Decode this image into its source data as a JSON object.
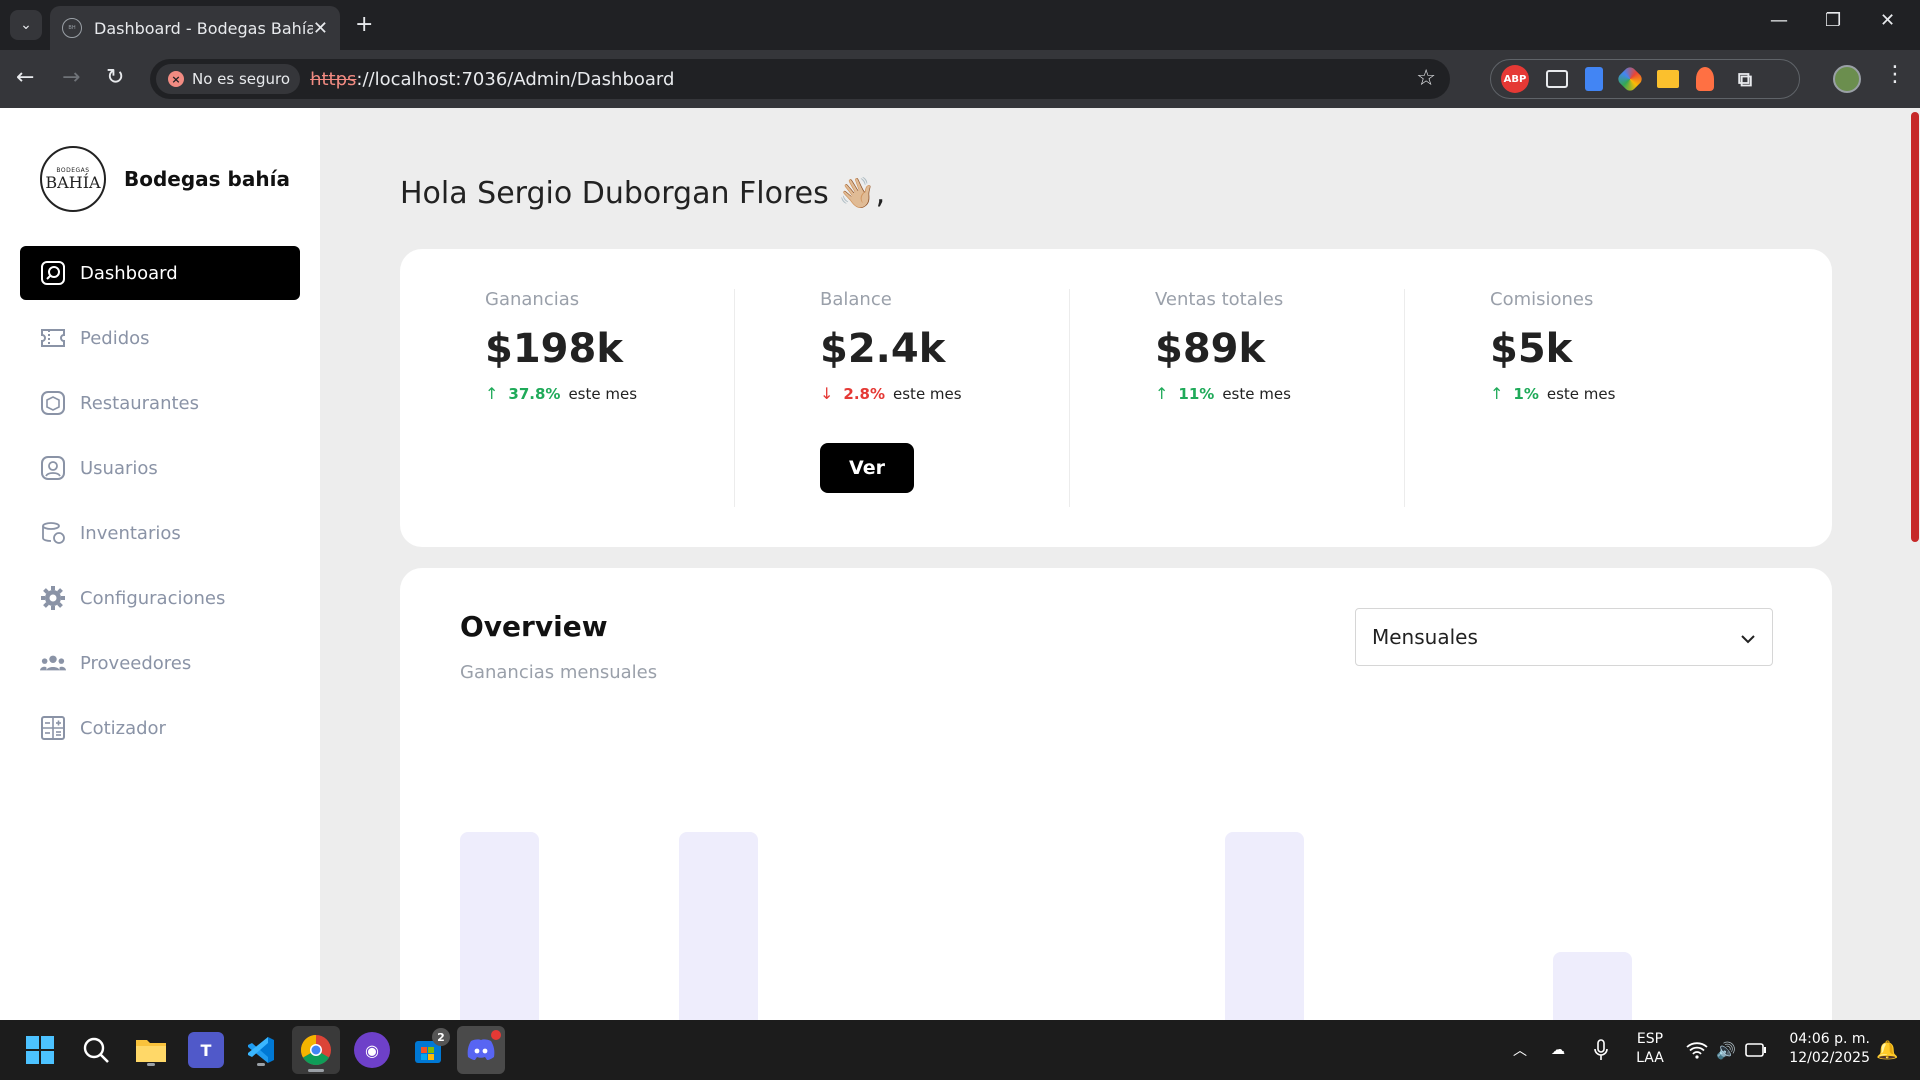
{
  "browser": {
    "tab_title": "Dashboard - Bodegas Bahía",
    "security_label": "No es seguro",
    "url_scheme": "https",
    "url_rest": "://localhost:7036/Admin/Dashboard"
  },
  "sidebar": {
    "brand_name": "Bodegas bahía",
    "logo_small": "BODEGAS",
    "logo_big": "BAHÍA",
    "items": [
      {
        "label": "Dashboard",
        "icon": "dashboard-icon"
      },
      {
        "label": "Pedidos",
        "icon": "ticket-icon"
      },
      {
        "label": "Restaurantes",
        "icon": "box-icon"
      },
      {
        "label": "Usuarios",
        "icon": "user-icon"
      },
      {
        "label": "Inventarios",
        "icon": "inventory-icon"
      },
      {
        "label": "Configuraciones",
        "icon": "gear-icon"
      },
      {
        "label": "Proveedores",
        "icon": "people-icon"
      },
      {
        "label": "Cotizador",
        "icon": "calculator-icon"
      }
    ]
  },
  "greeting": {
    "text": "Hola Sergio Duborgan Flores",
    "emoji": "👋🏼",
    "suffix": ","
  },
  "stats": [
    {
      "label": "Ganancias",
      "value": "$198k",
      "direction": "up",
      "pct": "37.8%",
      "period": "este mes"
    },
    {
      "label": "Balance",
      "value": "$2.4k",
      "direction": "down",
      "pct": "2.8%",
      "period": "este mes",
      "button": "Ver"
    },
    {
      "label": "Ventas totales",
      "value": "$89k",
      "direction": "up",
      "pct": "11%",
      "period": "este mes"
    },
    {
      "label": "Comisiones",
      "value": "$5k",
      "direction": "up",
      "pct": "1%",
      "period": "este mes"
    }
  ],
  "overview": {
    "title": "Overview",
    "subtitle": "Ganancias mensuales",
    "select_value": "Mensuales"
  },
  "chart_data": {
    "type": "bar",
    "values": [
      1.0,
      0.19,
      1.0,
      0,
      0,
      0,
      0,
      1.0,
      0,
      0,
      0.53
    ],
    "bar_color": "#eeedfc"
  },
  "taskbar": {
    "lang_top": "ESP",
    "lang_bottom": "LAA",
    "time": "04:06 p. m.",
    "date": "12/02/2025",
    "badge_count": "2"
  },
  "colors": {
    "accent": "#000000",
    "up": "#1faa59",
    "down": "#e53935"
  }
}
